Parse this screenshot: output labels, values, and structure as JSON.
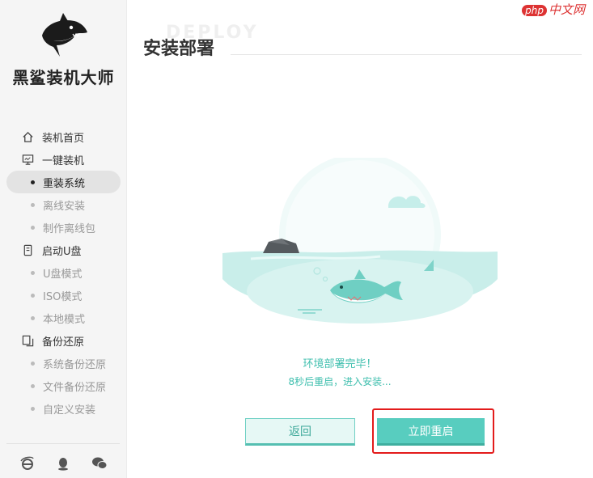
{
  "app": {
    "name": "黑鲨装机大师"
  },
  "site_badge": {
    "php": "php",
    "text": "中文网"
  },
  "sidebar": {
    "groups": [
      {
        "label": "装机首页",
        "icon": "home-icon",
        "items": []
      },
      {
        "label": "一键装机",
        "icon": "monitor-icon",
        "items": [
          {
            "label": "重装系统",
            "active": true
          },
          {
            "label": "离线安装",
            "active": false
          },
          {
            "label": "制作离线包",
            "active": false
          }
        ]
      },
      {
        "label": "启动U盘",
        "icon": "usb-icon",
        "items": [
          {
            "label": "U盘模式",
            "active": false
          },
          {
            "label": "ISO模式",
            "active": false
          },
          {
            "label": "本地模式",
            "active": false
          }
        ]
      },
      {
        "label": "备份还原",
        "icon": "backup-icon",
        "items": [
          {
            "label": "系统备份还原",
            "active": false
          },
          {
            "label": "文件备份还原",
            "active": false
          },
          {
            "label": "自定义安装",
            "active": false
          }
        ]
      }
    ],
    "footer_icons": [
      "ie-icon",
      "qq-icon",
      "wechat-icon"
    ]
  },
  "main": {
    "watermark": "DEPLOY",
    "title": "安装部署",
    "status_line1": "环境部署完毕！",
    "status_line2": "8秒后重启，进入安装...",
    "back_label": "返回",
    "restart_label": "立即重启"
  },
  "colors": {
    "accent": "#58cdbf",
    "highlight": "#e31b1b"
  }
}
